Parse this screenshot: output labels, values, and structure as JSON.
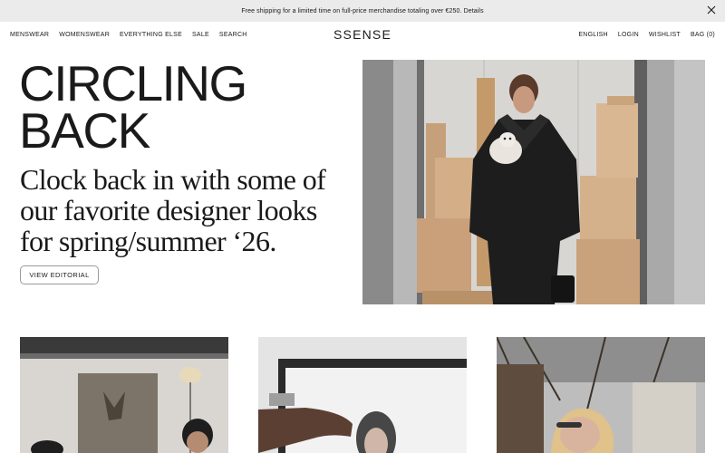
{
  "promo": {
    "text": "Free shipping for a limited time on full-price merchandise totaling over €250. Details"
  },
  "nav": {
    "left": [
      "MENSWEAR",
      "WOMENSWEAR",
      "EVERYTHING ELSE",
      "SALE",
      "SEARCH"
    ],
    "logo": "SSENSE",
    "right": [
      "ENGLISH",
      "LOGIN",
      "WISHLIST",
      "BAG (0)"
    ]
  },
  "hero": {
    "title_line1": "CIRCLING",
    "title_line2": "BACK",
    "subtitle": "Clock back in with some of our favorite designer looks for spring/summer ‘26.",
    "button_label": "VIEW EDITORIAL"
  },
  "icons": {
    "close": "close-icon"
  },
  "colors": {
    "promo_bg": "#ebebeb",
    "text": "#1a1a1a",
    "button_border": "#9a9a9a"
  }
}
